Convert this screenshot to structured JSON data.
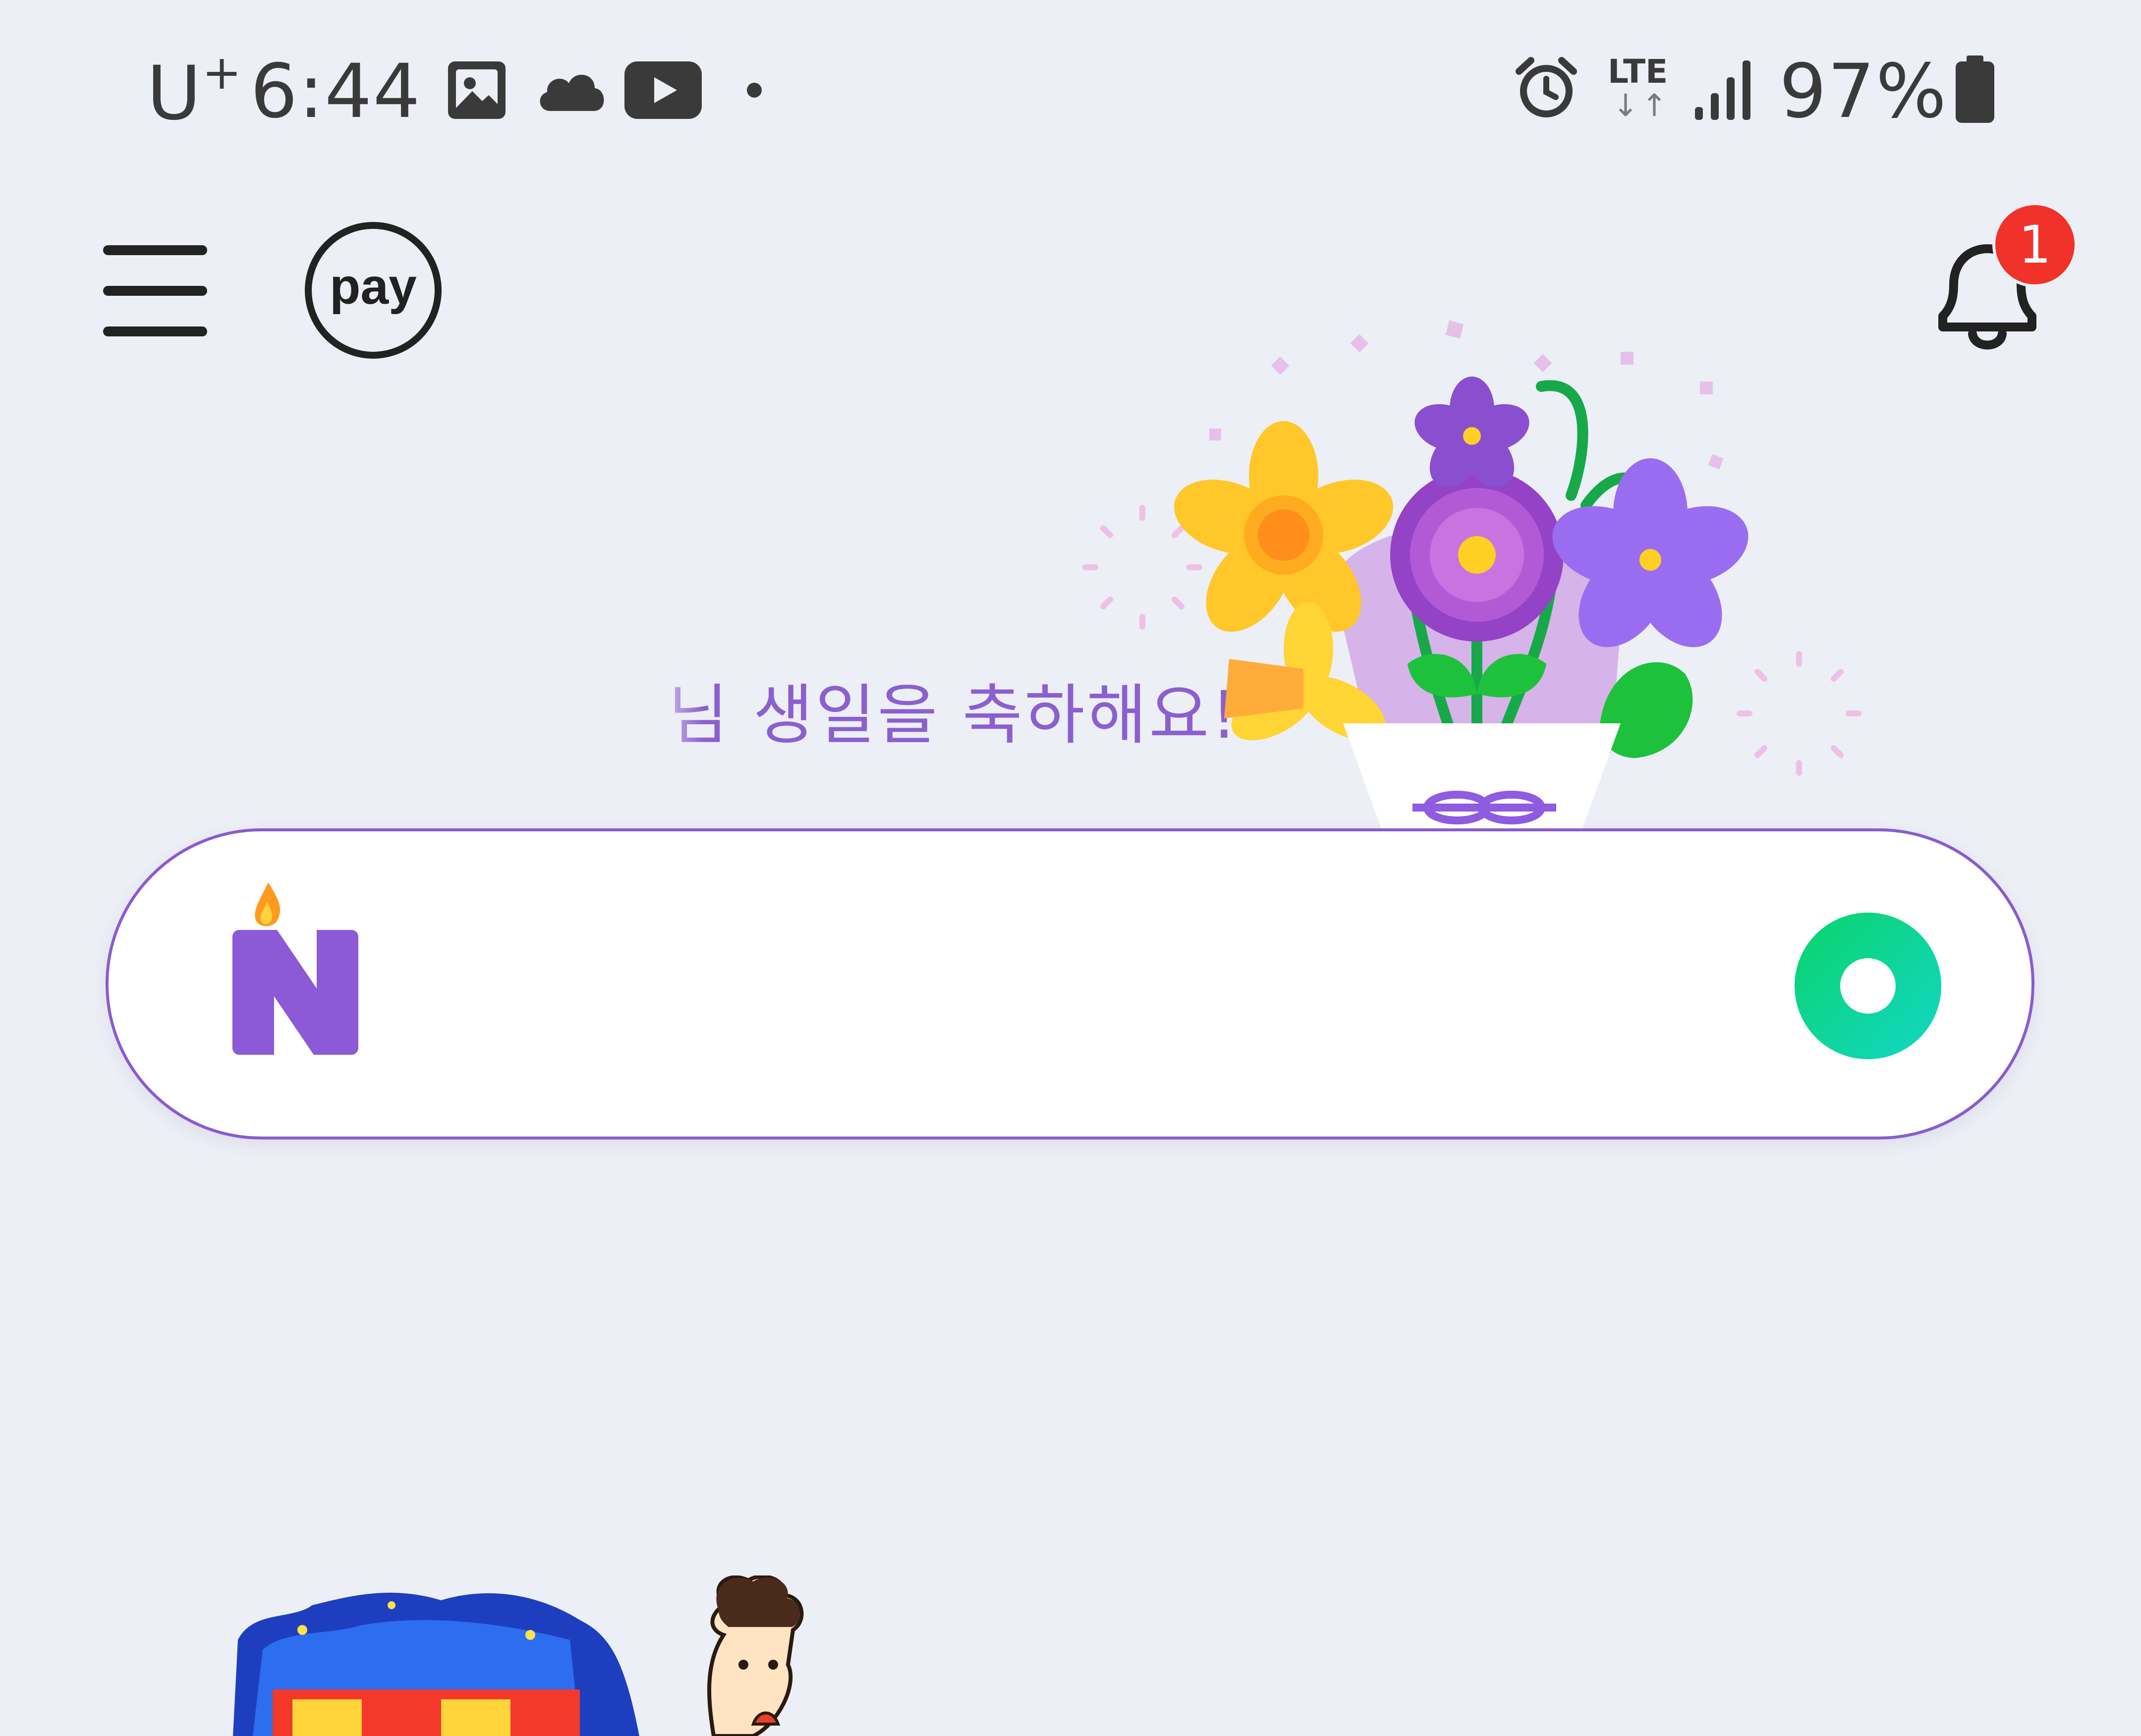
{
  "status_bar": {
    "carrier": "U",
    "carrier_sup": "+",
    "time": "6:44",
    "network": "LTE",
    "battery": "97%",
    "icons": [
      "gallery-icon",
      "cloud-icon",
      "youtube-icon",
      "dot-icon",
      "alarm-icon",
      "lte-icon",
      "signal-icon",
      "battery-icon"
    ]
  },
  "header": {
    "pay_label": "pay",
    "notification_count": "1"
  },
  "greeting": {
    "text": "님 생일을 축하해요!"
  },
  "search": {
    "value": "",
    "placeholder": ""
  },
  "colors": {
    "background": "#eceff5",
    "accent_purple": "#8a5bd0",
    "search_green": "#10d67a",
    "badge_red": "#f0322a"
  }
}
